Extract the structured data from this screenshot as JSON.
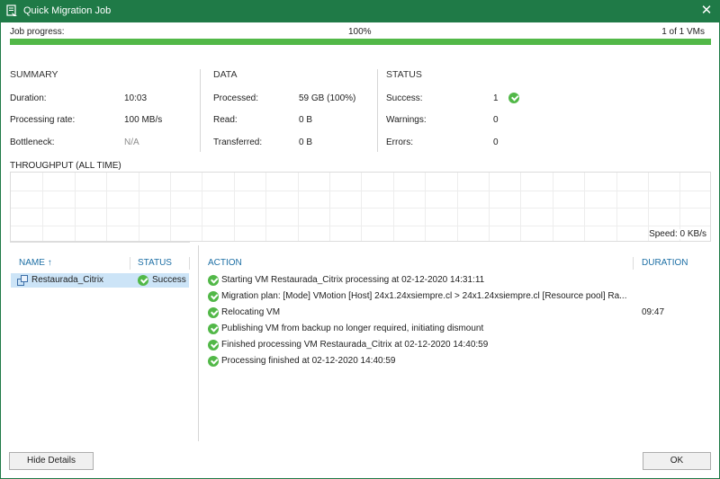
{
  "window": {
    "title": "Quick Migration Job",
    "close_glyph": "✕"
  },
  "progress": {
    "label": "Job progress:",
    "percent_text": "100%",
    "fraction": 1.0,
    "count_text": "1 of 1 VMs",
    "bar_color": "#52b848"
  },
  "summary": {
    "title": "SUMMARY",
    "duration_label": "Duration:",
    "duration_value": "10:03",
    "rate_label": "Processing rate:",
    "rate_value": "100 MB/s",
    "bottleneck_label": "Bottleneck:",
    "bottleneck_value": "N/A"
  },
  "data_section": {
    "title": "DATA",
    "processed_label": "Processed:",
    "processed_value": "59 GB (100%)",
    "read_label": "Read:",
    "read_value": "0 B",
    "transferred_label": "Transferred:",
    "transferred_value": "0 B"
  },
  "status_section": {
    "title": "STATUS",
    "success_label": "Success:",
    "success_value": "1",
    "warnings_label": "Warnings:",
    "warnings_value": "0",
    "errors_label": "Errors:",
    "errors_value": "0"
  },
  "throughput": {
    "title": "THROUGHPUT (ALL TIME)",
    "speed_text": "Speed: 0 KB/s"
  },
  "vm_list": {
    "name_header": "NAME",
    "sort_glyph": "↑",
    "status_header": "STATUS",
    "rows": [
      {
        "name": "Restaurada_Citrix",
        "status": "Success"
      }
    ]
  },
  "log": {
    "action_header": "ACTION",
    "duration_header": "DURATION",
    "rows": [
      {
        "text": "Starting VM Restaurada_Citrix processing at 02-12-2020 14:31:11",
        "duration": ""
      },
      {
        "text": "Migration plan:  [Mode] VMotion  [Host] 24x1.24xsiempre.cl > 24x1.24xsiempre.cl [Resource pool] Ra...",
        "duration": ""
      },
      {
        "text": "Relocating VM",
        "duration": "09:47"
      },
      {
        "text": "Publishing VM from backup no longer required, initiating dismount",
        "duration": ""
      },
      {
        "text": "Finished processing VM Restaurada_Citrix at 02-12-2020 14:40:59",
        "duration": ""
      },
      {
        "text": "Processing finished at 02-12-2020 14:40:59",
        "duration": ""
      }
    ]
  },
  "buttons": {
    "hide_details": "Hide Details",
    "ok": "OK"
  },
  "colors": {
    "titlebar": "#1f7a47",
    "success": "#52b848",
    "header_link": "#1d6fa5",
    "selection": "#cce4f7"
  },
  "icons": {
    "app": "veeam-job-icon",
    "vm": "vm-icon",
    "status": "check-circle-icon"
  }
}
